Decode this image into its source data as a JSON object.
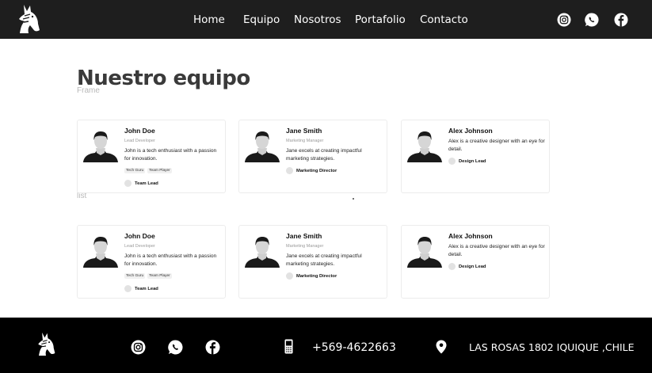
{
  "header": {
    "logo_icon": "horse-head-logo",
    "nav": [
      "Home",
      "Equipo",
      "Nosotros",
      "Portafolio",
      "Contacto"
    ],
    "social_icons": [
      "instagram-icon",
      "whatsapp-icon",
      "facebook-icon"
    ]
  },
  "main": {
    "title": "Nuestro equipo",
    "ghost_frame": "Frame",
    "ghost_list": "list",
    "rows": [
      [
        {
          "name": "John Doe",
          "role": "Lead Developer",
          "bio": "John is a tech enthusiast with a passion for innovation.",
          "tags": [
            "Tech Guru",
            "Team Player"
          ],
          "badge": "Team Lead"
        },
        {
          "name": "Jane Smith",
          "role": "Marketing Manager",
          "bio": "Jane excels at creating impactful marketing strategies.",
          "tags": [],
          "badge": "Marketing Director"
        },
        {
          "name": "Alex Johnson",
          "role": "",
          "bio": "Alex is a creative designer with an eye for detail.",
          "tags": [],
          "badge": "Design Lead"
        }
      ],
      [
        {
          "name": "John Doe",
          "role": "Lead Developer",
          "bio": "John is a tech enthusiast with a passion for innovation.",
          "tags": [
            "Tech Guru",
            "Team Player"
          ],
          "badge": "Team Lead"
        },
        {
          "name": "Jane Smith",
          "role": "Marketing Manager",
          "bio": "Jane excels at creating impactful marketing strategies.",
          "tags": [],
          "badge": "Marketing Director"
        },
        {
          "name": "Alex Johnson",
          "role": "",
          "bio": "Alex is a creative designer with an eye for detail.",
          "tags": [],
          "badge": "Design Lead"
        }
      ]
    ]
  },
  "footer": {
    "logo_icon": "horse-head-logo",
    "social_icons": [
      "instagram-icon",
      "whatsapp-icon",
      "facebook-icon"
    ],
    "phone_icon": "mobile-phone-icon",
    "phone": "+569-4622663",
    "location_icon": "map-pin-icon",
    "address": "LAS ROSAS 1802 IQUIQUE ,CHILE"
  },
  "colors": {
    "header_bg": "#1e1e1e",
    "footer_bg": "#000000",
    "title": "#3a3a3a"
  }
}
